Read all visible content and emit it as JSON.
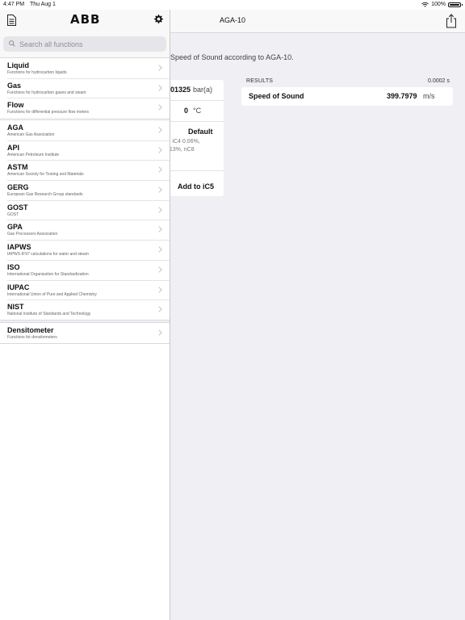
{
  "status_bar": {
    "time": "4:47 PM",
    "date": "Thu Aug 1",
    "battery": "100%"
  },
  "sidebar": {
    "logo": "ABB",
    "search_placeholder": "Search all functions",
    "groups": [
      {
        "items": [
          {
            "title": "Liquid",
            "subtitle": "Functions for hydrocarbon liquids"
          },
          {
            "title": "Gas",
            "subtitle": "Functions for hydrocarbon gases and steam"
          },
          {
            "title": "Flow",
            "subtitle": "Functions for differential pressure flow meters"
          }
        ]
      },
      {
        "items": [
          {
            "title": "AGA",
            "subtitle": "American Gas Association"
          },
          {
            "title": "API",
            "subtitle": "American Petroleum Institute"
          },
          {
            "title": "ASTM",
            "subtitle": "American Society for Testing and Materials"
          },
          {
            "title": "GERG",
            "subtitle": "European Gas Research Group standards"
          },
          {
            "title": "GOST",
            "subtitle": "GOST"
          },
          {
            "title": "GPA",
            "subtitle": "Gas Processors Association"
          },
          {
            "title": "IAPWS",
            "subtitle": "IAPWS-IF97 calculations for water and steam"
          },
          {
            "title": "ISO",
            "subtitle": "International Organization for Standardization"
          },
          {
            "title": "IUPAC",
            "subtitle": "International Union of Pure and Applied Chemistry"
          },
          {
            "title": "NIST",
            "subtitle": "National Institute of Standards and Technology"
          }
        ]
      },
      {
        "items": [
          {
            "title": "Densitometer",
            "subtitle": "Functions for densitometers"
          }
        ]
      }
    ]
  },
  "detail": {
    "title": "AGA-10",
    "description": "Speed of Sound according to AGA-10.",
    "inputs": {
      "pressure_value": "01325",
      "pressure_unit": "bar(a)",
      "temperature_value": "0",
      "temperature_unit": "°C",
      "composition_mode": "Default",
      "composition_line1": "s, iC4 0.06%,",
      "composition_line2": "013%, nC8",
      "add_label": "Add to iC5"
    },
    "results": {
      "header": "RESULTS",
      "elapsed": "0.0002 s",
      "name": "Speed of Sound",
      "value": "399.7979",
      "unit": "m/s"
    }
  }
}
